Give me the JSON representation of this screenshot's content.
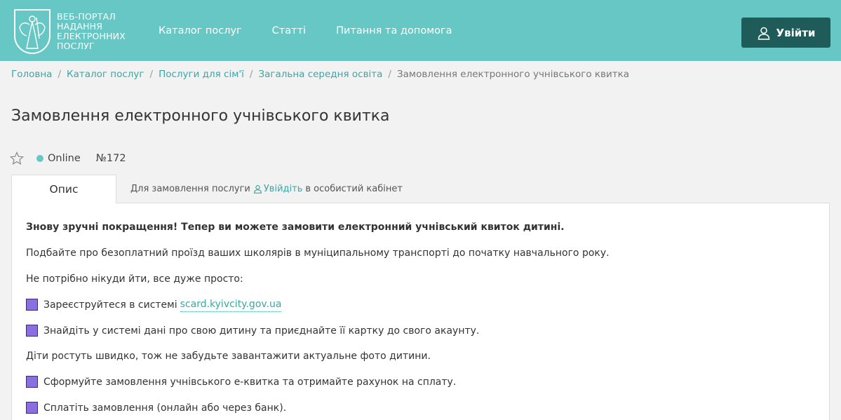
{
  "header": {
    "logo_lines": [
      "ВЕБ-ПОРТАЛ",
      "НАДАННЯ",
      "ЕЛЕКТРОННИХ",
      "ПОСЛУГ"
    ],
    "nav": [
      "Каталог послуг",
      "Статті",
      "Питання та допомога"
    ],
    "login_label": "Увійти",
    "bg_color": "#67c7c5",
    "button_color": "#1f5c59"
  },
  "breadcrumb": {
    "items": [
      "Головна",
      "Каталог послуг",
      "Послуги для сім'ї",
      "Загальна середня освіта"
    ],
    "current": "Замовлення електронного учнівського квитка"
  },
  "page": {
    "title": "Замовлення електронного учнівського квитка",
    "status": "Online",
    "number": "№172"
  },
  "tabs": {
    "active": "Опис",
    "hint_before": "Для замовлення послуги",
    "hint_link": "Увійдіть",
    "hint_after": "в особистий кабінет"
  },
  "content": {
    "intro": "Знову зручні покращення! Тепер ви можете замовити електронний учнівський квиток дитині.",
    "p1": "Подбайте про безоплатний проїзд ваших школярів в муніципальному транспорті до початку навчального року.",
    "p2": "Не потрібно нікуди йти, все дуже просто:",
    "step1_text": "Зареєструйтеся в системі",
    "step1_link": "scard.kyivcity.gov.ua",
    "step2": "Знайдіть у системі дані про свою дитину та приєднайте її картку до свого акаунту.",
    "p3": "Діти ростуть швидко, тож не забудьте завантажити актуальне фото дитини.",
    "step3": "Сформуйте замовлення учнівського е-квитка та отримайте рахунок на сплату.",
    "step4": "Сплатіть замовлення (онлайн або через банк)."
  }
}
